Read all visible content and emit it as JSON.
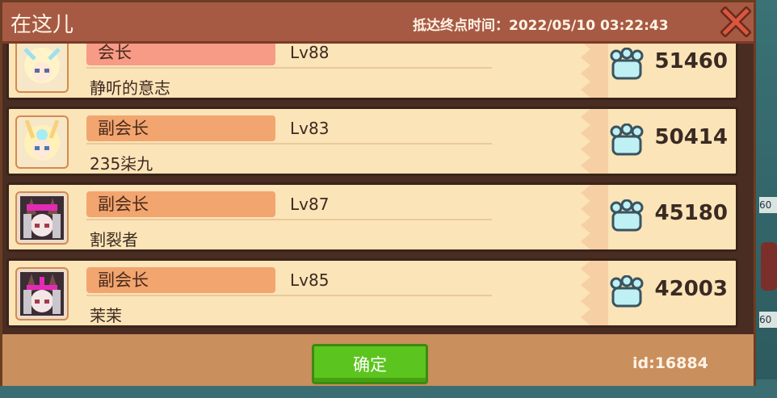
{
  "dialog": {
    "title": "在这儿",
    "arrival_label": "抵达终点时间：",
    "arrival_time": "2022/05/10 03:22:43",
    "confirm_label": "确定",
    "user_id": "id:16884"
  },
  "members": [
    {
      "role": "会长",
      "level": "Lv88",
      "name": "静听的意志",
      "score": "51460",
      "avatar": "light"
    },
    {
      "role": "副会长",
      "level": "Lv83",
      "name": "235柒九",
      "score": "50414",
      "avatar": "light"
    },
    {
      "role": "副会长",
      "level": "Lv87",
      "name": "割裂者",
      "score": "45180",
      "avatar": "dark"
    },
    {
      "role": "副会长",
      "level": "Lv85",
      "name": "茉茉",
      "score": "42003",
      "avatar": "dark"
    }
  ],
  "background": {
    "tags": [
      "60",
      "60"
    ]
  },
  "icons": {
    "close": "close-x-icon",
    "score": "paw-icon"
  },
  "colors": {
    "title_bar": "#a75a43",
    "row_bg": "#fbe4b8",
    "role_badge": "#f2a56f",
    "confirm": "#5cc41e",
    "paw": "#bff0f4"
  }
}
